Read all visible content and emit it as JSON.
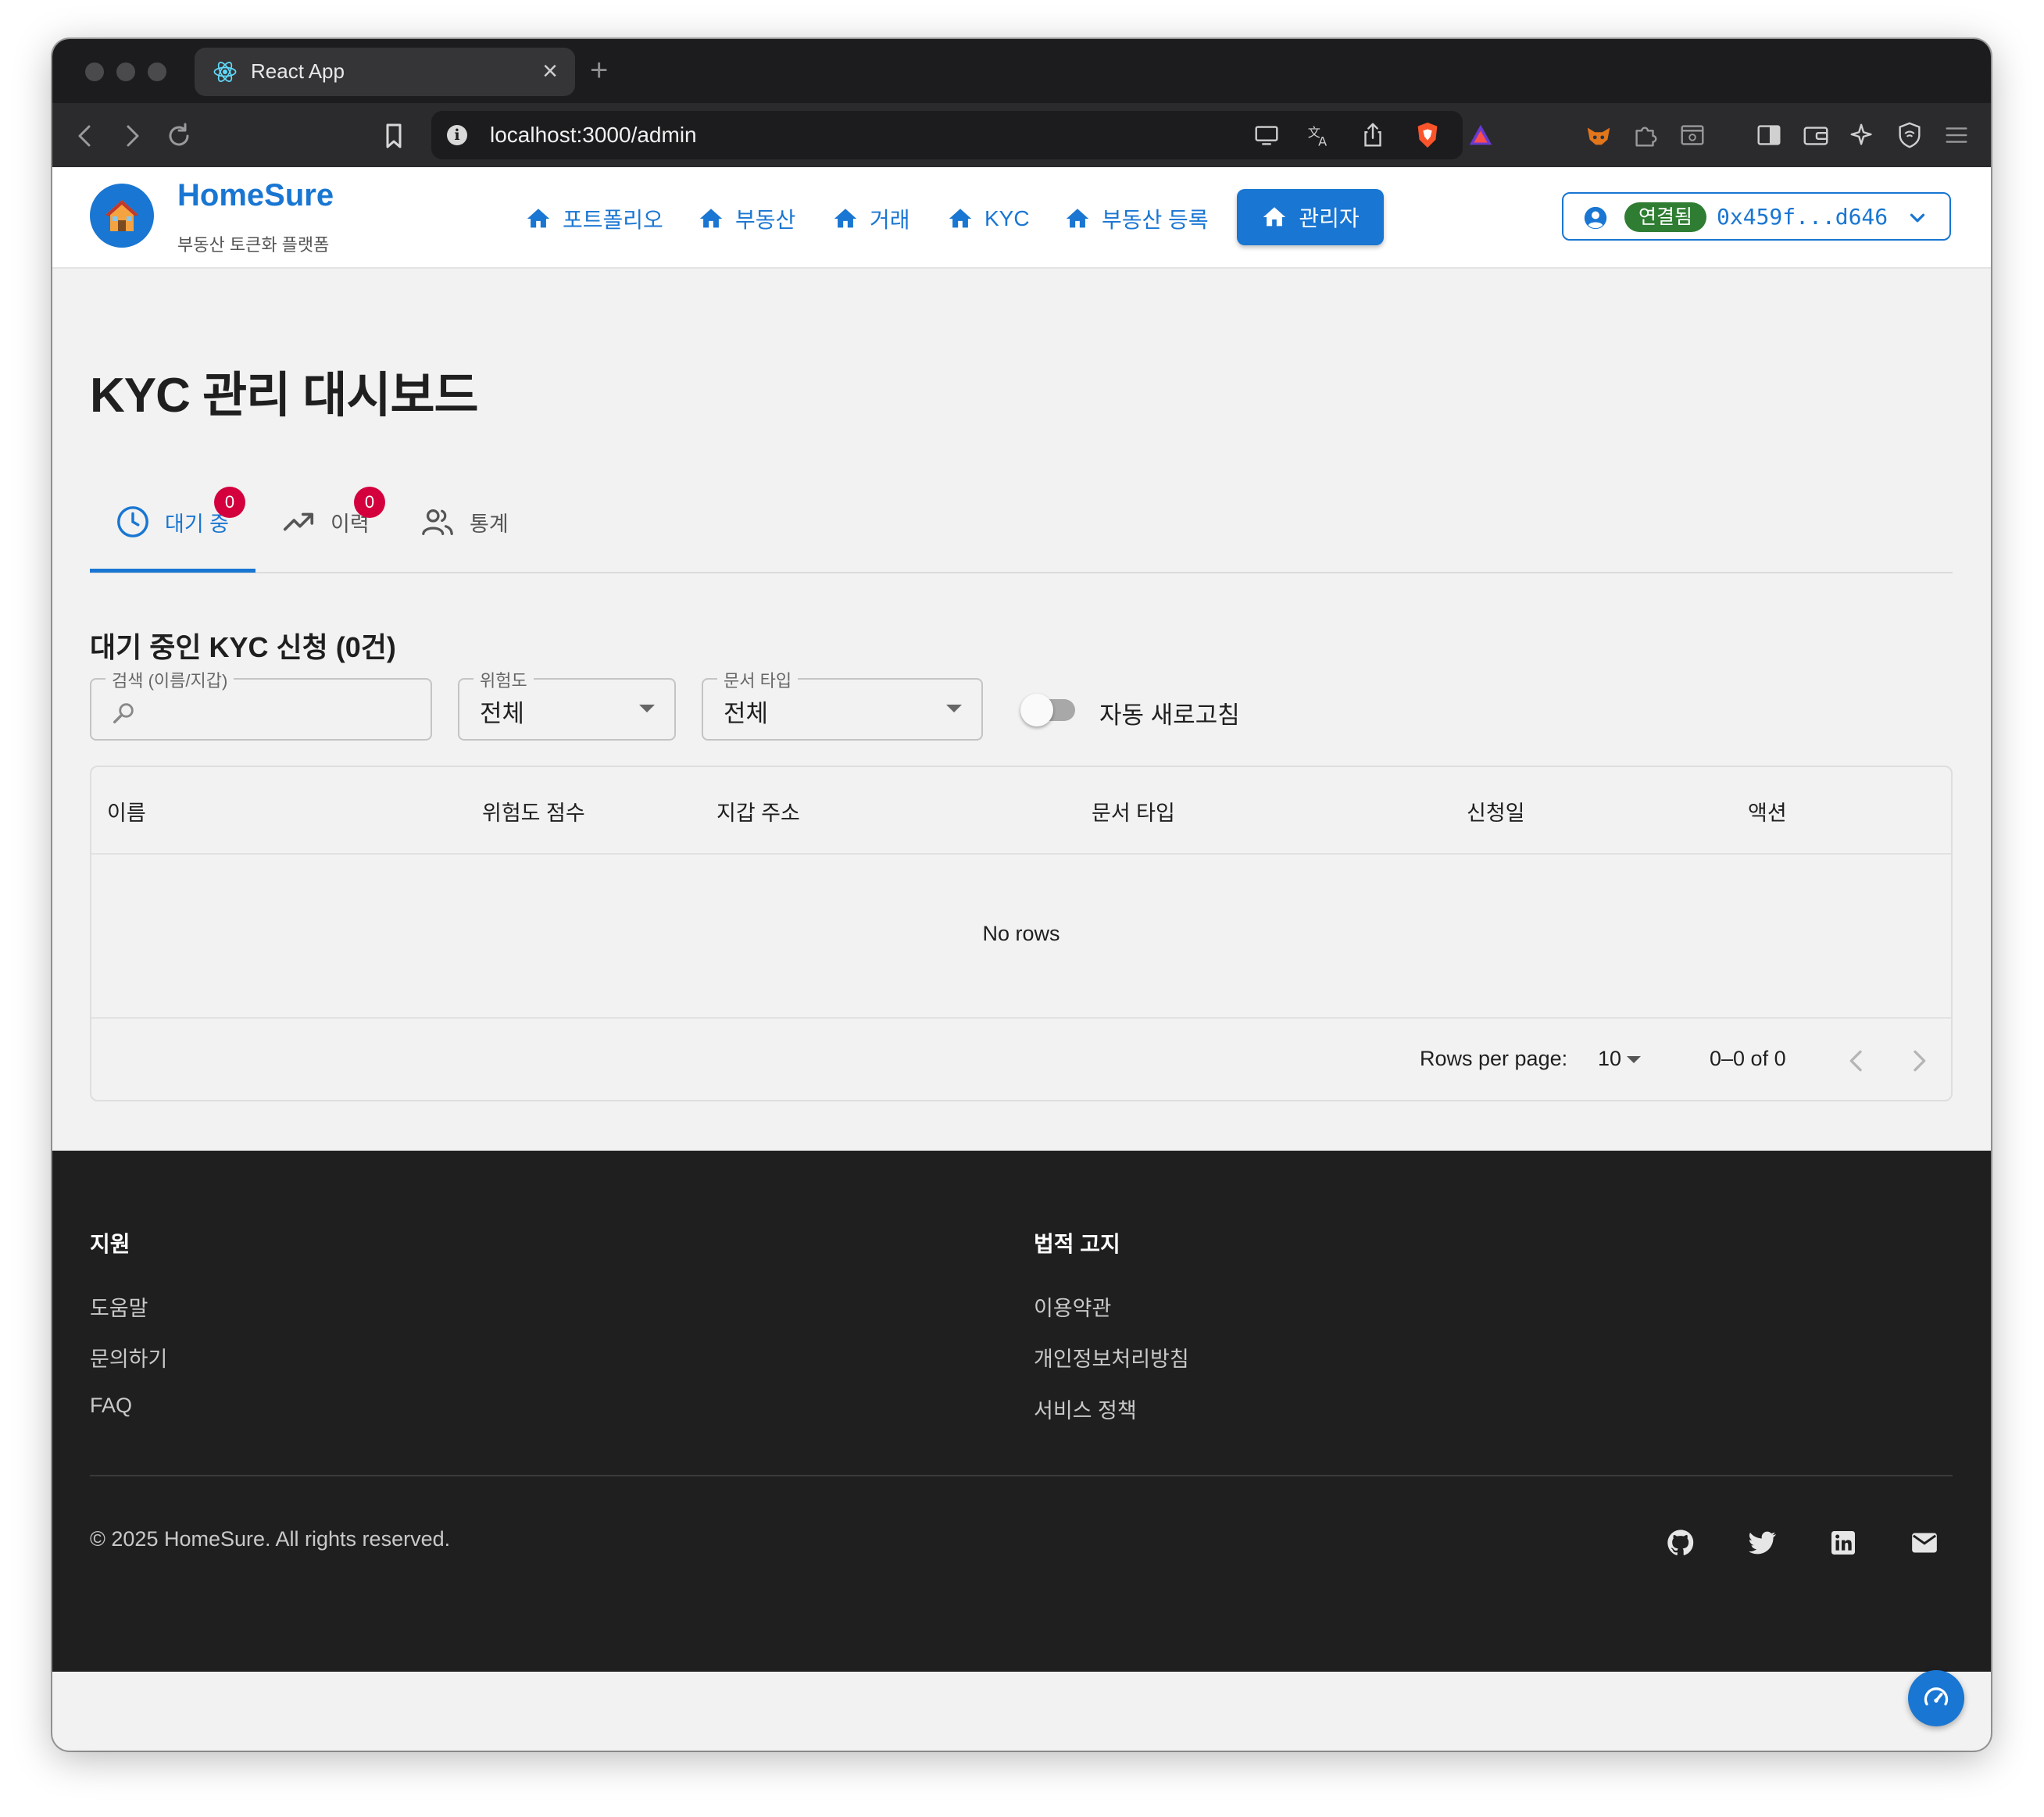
{
  "browser": {
    "tab_title": "React App",
    "url": "localhost:3000/admin"
  },
  "header": {
    "brand": "HomeSure",
    "brand_subtitle": "부동산 토큰화 플랫폼",
    "nav": [
      {
        "label": "포트폴리오"
      },
      {
        "label": "부동산"
      },
      {
        "label": "거래"
      },
      {
        "label": "KYC"
      },
      {
        "label": "부동산 등록"
      },
      {
        "label": "관리자",
        "active": true
      }
    ],
    "wallet": {
      "status": "연결됨",
      "address": "0x459f...d646"
    }
  },
  "main": {
    "title": "KYC 관리 대시보드",
    "tabs": [
      {
        "label": "대기 중",
        "badge": "0",
        "icon": "clock-icon"
      },
      {
        "label": "이력",
        "badge": "0",
        "icon": "trending-up-icon"
      },
      {
        "label": "통계",
        "icon": "people-icon"
      }
    ],
    "section_title": "대기 중인 KYC 신청 (0건)",
    "filters": {
      "search_label": "검색 (이름/지갑)",
      "search_value": "",
      "risk_label": "위험도",
      "risk_value": "전체",
      "doc_label": "문서 타입",
      "doc_value": "전체",
      "auto_refresh_label": "자동 새로고침",
      "auto_refresh_on": false
    },
    "table": {
      "columns": [
        "이름",
        "위험도 점수",
        "지갑 주소",
        "문서 타입",
        "신청일",
        "액션"
      ],
      "rows": [],
      "empty_text": "No rows",
      "rows_per_page_label": "Rows per page:",
      "rows_per_page": "10",
      "range_text": "0–0 of 0"
    }
  },
  "footer": {
    "support_title": "지원",
    "support_links": [
      "도움말",
      "문의하기",
      "FAQ"
    ],
    "legal_title": "법적 고지",
    "legal_links": [
      "이용약관",
      "개인정보처리방침",
      "서비스 정책"
    ],
    "copyright": "© 2025 HomeSure. All rights reserved.",
    "social_icons": [
      "github-icon",
      "twitter-icon",
      "linkedin-icon",
      "mail-icon"
    ]
  },
  "colors": {
    "primary": "#1976d2",
    "connected": "#2e7d32",
    "badge": "#d3003d",
    "footer_bg": "#1f1f20"
  }
}
